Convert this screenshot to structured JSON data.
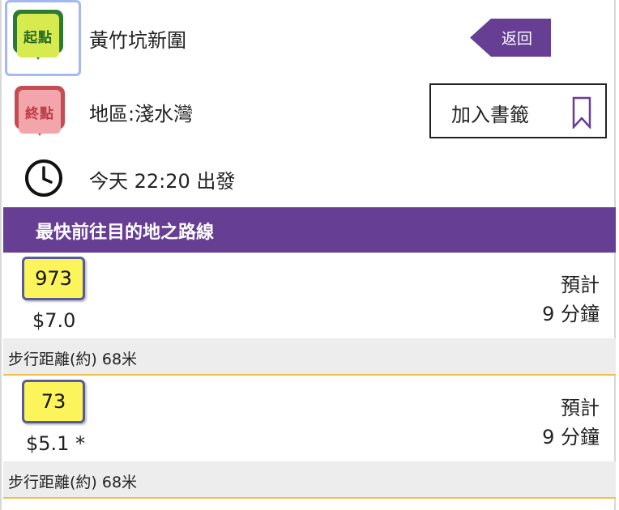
{
  "origin": {
    "pin_label": "起點",
    "name": "黃竹坑新圍"
  },
  "destination": {
    "pin_label": "終點",
    "name": "地區:淺水灣"
  },
  "departure": {
    "text": "今天 22:20 出發"
  },
  "actions": {
    "back_label": "返回",
    "bookmark_label": "加入書籤"
  },
  "section": {
    "title": "最快前往目的地之路線"
  },
  "routes": [
    {
      "number": "973",
      "fare": "$7.0",
      "eta_label": "預計",
      "eta_value": "9 分鐘",
      "walk": "步行距離(約) 68米"
    },
    {
      "number": "73",
      "fare": "$5.1 *",
      "eta_label": "預計",
      "eta_value": "9 分鐘",
      "walk": "步行距離(約) 68米"
    }
  ],
  "colors": {
    "accent_purple": "#663f94",
    "badge_yellow": "#fbf45a",
    "start_green": "#2f7a33",
    "end_red": "#c24d55",
    "divider_gold": "#f0c04a"
  },
  "icons": [
    "start-pin-icon",
    "end-pin-icon",
    "clock-icon",
    "bookmark-icon"
  ]
}
